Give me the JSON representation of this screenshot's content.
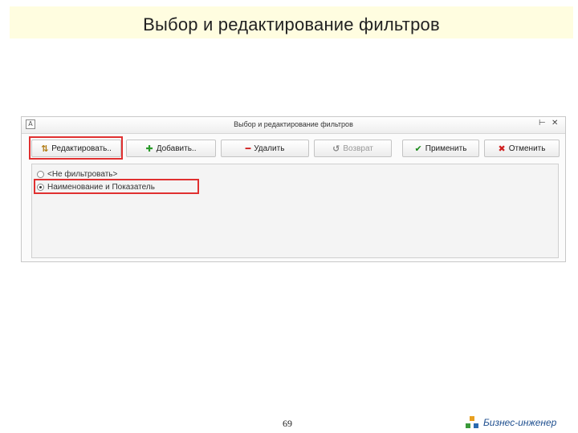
{
  "slide": {
    "title": "Выбор и редактирование фильтров",
    "page_number": "69",
    "brand": "Бизнес-инженер"
  },
  "window": {
    "title": "Выбор и редактирование фильтров",
    "icon": "app-icon",
    "controls": [
      "pin-icon",
      "close-icon"
    ]
  },
  "toolbar": {
    "edit_label": "Редактировать..",
    "add_label": "Добавить..",
    "delete_label": "Удалить",
    "back_label": "Возврат",
    "apply_label": "Применить",
    "cancel_label": "Отменить"
  },
  "filters": [
    {
      "label": "<Не фильтровать>",
      "selected": false
    },
    {
      "label": "Наименование и Показатель",
      "selected": true
    }
  ],
  "colors": {
    "highlight": "#e03030",
    "title_bg": "#fffde0",
    "add_icon": "#2a9a2a",
    "delete_icon": "#d02020",
    "apply_icon": "#1a8a1a",
    "cancel_icon": "#d02020",
    "brand_text": "#1f4f8f"
  }
}
